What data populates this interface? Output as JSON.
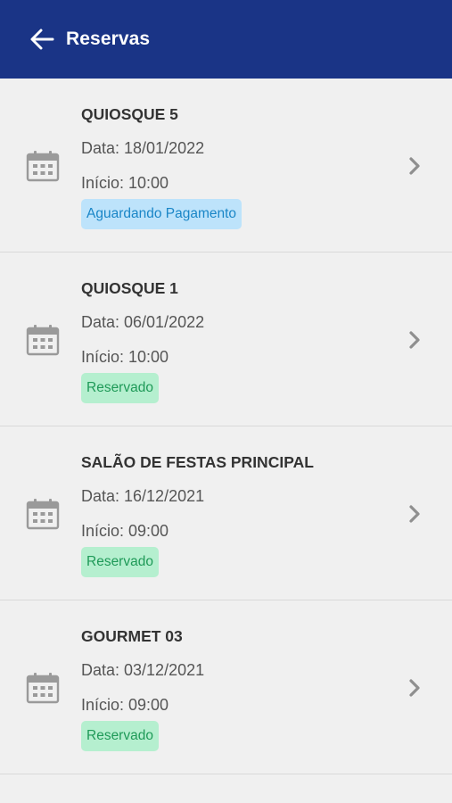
{
  "appbar": {
    "title": "Reservas",
    "back_icon": "arrow-left-icon",
    "background": "#1a3486"
  },
  "reservations": [
    {
      "title": "QUIOSQUE 5",
      "date": "Data: 18/01/2022",
      "start": "Início: 10:00",
      "status": "Aguardando Pagamento",
      "status_color": "blue"
    },
    {
      "title": "QUIOSQUE 1",
      "date": "Data: 06/01/2022",
      "start": "Início: 10:00",
      "status": "Reservado",
      "status_color": "green"
    },
    {
      "title": "SALÃO DE FESTAS PRINCIPAL",
      "date": "Data: 16/12/2021",
      "start": "Início: 09:00",
      "status": "Reservado",
      "status_color": "green"
    },
    {
      "title": "GOURMET 03",
      "date": "Data: 03/12/2021",
      "start": "Início: 09:00",
      "status": "Reservado",
      "status_color": "green"
    }
  ],
  "icons": {
    "item_icon": "calendar-icon",
    "item_action_icon": "chevron-right-icon"
  }
}
